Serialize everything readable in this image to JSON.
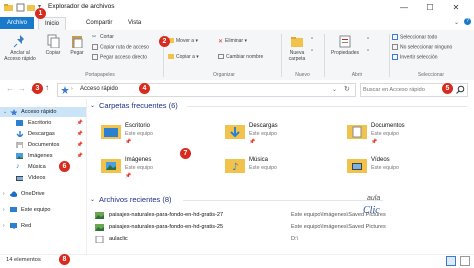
{
  "window": {
    "title": "Explorador de archivos",
    "controls": {
      "minimize": "—",
      "maximize": "☐",
      "close": "✕"
    }
  },
  "tabs": [
    {
      "label": "Archivo"
    },
    {
      "label": "Inicio"
    },
    {
      "label": "Compartir"
    },
    {
      "label": "Vista"
    }
  ],
  "ribbon": {
    "anclar": "Anclar al Acceso rápido",
    "copiar": "Copiar",
    "pegar": "Pegar",
    "cortar": "Cortar",
    "copiar_ruta": "Copiar ruta de acceso",
    "pegar_acceso": "Pegar acceso directo",
    "group_portapapeles": "Portapapeles",
    "mover_a": "Mover a",
    "copiar_a": "Copiar a",
    "eliminar": "Eliminar",
    "cambiar_nombre": "Cambiar nombre",
    "group_organizar": "Organizar",
    "nueva_carpeta": "Nueva carpeta",
    "group_nuevo": "Nuevo",
    "propiedades": "Propiedades",
    "group_abrir": "Abrir",
    "seleccionar_todo": "Seleccionar todo",
    "no_seleccionar": "No seleccionar ninguno",
    "invertir": "Invertir selección",
    "group_seleccionar": "Seleccionar"
  },
  "address": {
    "path": "Acceso rápido",
    "search_placeholder": "Buscar en Acceso rápido"
  },
  "nav": [
    {
      "label": "Acceso rápido",
      "pinned": false,
      "selected": true
    },
    {
      "label": "Escritorio",
      "pinned": true
    },
    {
      "label": "Descargas",
      "pinned": true
    },
    {
      "label": "Documentos",
      "pinned": true
    },
    {
      "label": "Imágenes",
      "pinned": true
    },
    {
      "label": "Música",
      "pinned": false
    },
    {
      "label": "Vídeos",
      "pinned": false
    },
    {
      "label": "OneDrive",
      "pinned": false
    },
    {
      "label": "Este equipo",
      "pinned": false
    },
    {
      "label": "Red",
      "pinned": false
    }
  ],
  "frequent": {
    "header": "Carpetas frecuentes (6)",
    "items": [
      {
        "name": "Escritorio",
        "location": "Este equipo"
      },
      {
        "name": "Descargas",
        "location": "Este equipo"
      },
      {
        "name": "Documentos",
        "location": "Este equipo"
      },
      {
        "name": "Imágenes",
        "location": "Este equipo"
      },
      {
        "name": "Música",
        "location": "Este equipo"
      },
      {
        "name": "Vídeos",
        "location": "Este equipo"
      }
    ]
  },
  "recent": {
    "header": "Archivos recientes (8)",
    "items": [
      {
        "name": "paisajes-naturales-para-fondo-en-hd-gratis-27",
        "path": "Este equipo\\Imágenes\\Saved Pictures"
      },
      {
        "name": "paisajes-naturales-para-fondo-en-hd-gratis-25",
        "path": "Este equipo\\Imágenes\\Saved Pictures"
      },
      {
        "name": "aulaclic",
        "path": "D:\\"
      }
    ]
  },
  "status": {
    "count": "14 elementos"
  },
  "watermark": {
    "line1": "aula",
    "line2": "Clic"
  },
  "callouts": [
    "1",
    "2",
    "3",
    "4",
    "5",
    "6",
    "7",
    "8"
  ],
  "colors": {
    "accent": "#1979ca",
    "callout": "#d82b1f",
    "folder": "#f1c34c",
    "section": "#1e3287"
  }
}
